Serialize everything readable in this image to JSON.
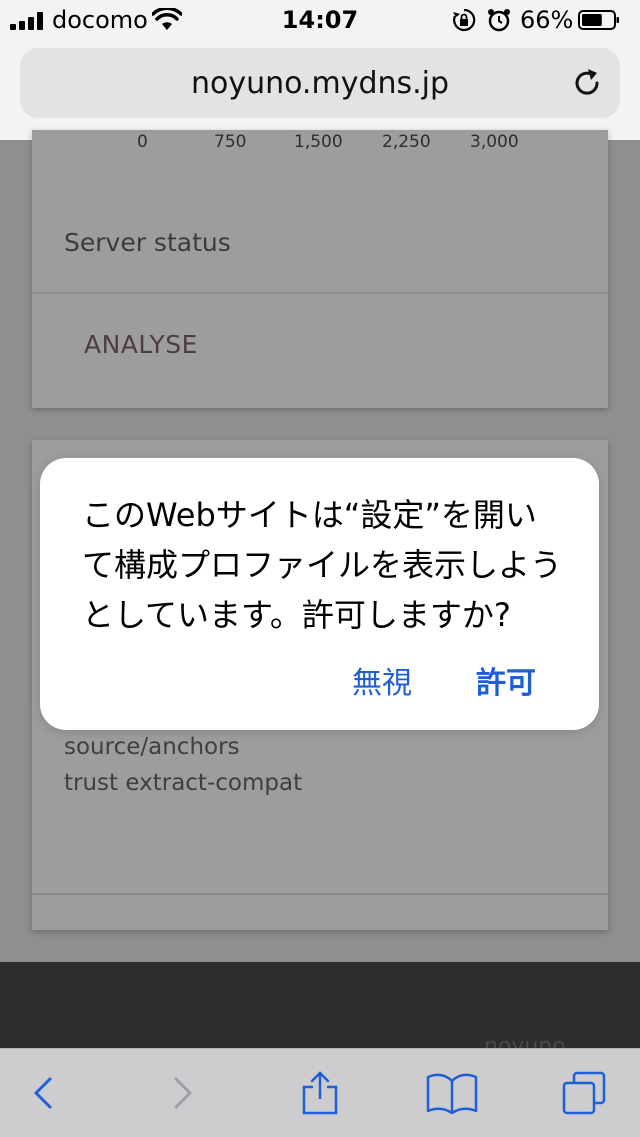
{
  "status_bar": {
    "carrier": "docomo",
    "time": "14:07",
    "battery_percent": "66%",
    "battery_level": 0.66,
    "icons": [
      "signal-icon",
      "wifi-icon",
      "orientation-lock-icon",
      "alarm-icon",
      "battery-icon"
    ]
  },
  "browser": {
    "url": "noyuno.mydns.jp",
    "reload_icon": "reload-icon"
  },
  "page": {
    "axis_ticks": [
      "0",
      "750",
      "1,500",
      "2,250",
      "3,000"
    ],
    "server_status_label": "Server status",
    "analyse_button": "ANALYSE",
    "card2_lines": [
      "source/anchors",
      "trust extract-compat"
    ],
    "footer_text": "noyuno"
  },
  "alert": {
    "message": "このWebサイトは“設定”を開いて構成プロファイルを表示しようとしています。許可しますか?",
    "ignore_label": "無視",
    "allow_label": "許可"
  },
  "toolbar": {
    "icons": [
      "back-icon",
      "forward-icon",
      "share-icon",
      "bookmarks-icon",
      "tabs-icon"
    ]
  },
  "colors": {
    "accent": "#1e5fd6",
    "overlay_bg": "#8f8f8f",
    "footer_bg": "#2d2d2d",
    "toolbar_bg": "#cdcdcf"
  }
}
